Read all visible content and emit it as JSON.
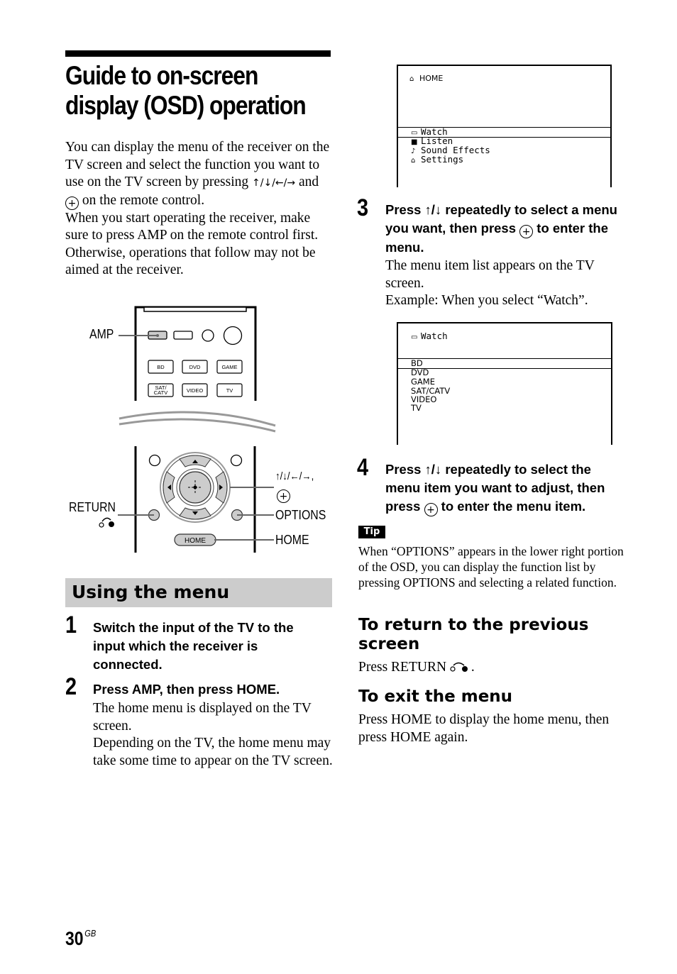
{
  "page": {
    "title_line1": "Guide to on-screen",
    "title_line2": "display (OSD) operation",
    "page_number": "30",
    "page_suffix": "GB"
  },
  "intro": {
    "line1_pre": "You can display the menu of the receiver on the TV screen and select the function you want to use on the TV screen by pressing ",
    "arrows": "↑/↓/←/→",
    "and": " and ",
    "enter_symbol": "+",
    "line1_post": " on the remote control.",
    "para2": "When you start operating the receiver, make sure to press AMP on the remote control first. Otherwise, operations that follow may not be aimed at the receiver."
  },
  "remote": {
    "callouts": {
      "amp": "AMP",
      "return": "RETURN",
      "arrows": "↑/↓/←/→,",
      "options": "OPTIONS",
      "home": "HOME"
    },
    "input_buttons": [
      "BD",
      "DVD",
      "GAME",
      "SAT/\nCATV",
      "VIDEO",
      "TV"
    ],
    "input_buttons_line1": [
      "BD",
      "DVD",
      "GAME",
      "SAT/",
      "VIDEO",
      "TV"
    ],
    "sat_line2": "CATV",
    "home_button": "HOME"
  },
  "section": {
    "title": "Using the menu"
  },
  "steps": [
    {
      "number": "1",
      "heading": "Switch the input of the TV to the input which the receiver is connected."
    },
    {
      "number": "2",
      "heading": "Press AMP, then press HOME.",
      "body1": "The home menu is displayed on the TV screen.",
      "body2": "Depending on the TV, the home menu may take some time to appear on the TV screen."
    },
    {
      "number": "3",
      "heading_pre": "Press ↑/↓ repeatedly to select a menu you want, then press ",
      "heading_post": " to enter the menu.",
      "body1": "The menu item list appears on the TV screen.",
      "body2": "Example: When you select “Watch”."
    },
    {
      "number": "4",
      "heading_pre": "Press ↑/↓ repeatedly to select the menu item you want to adjust, then press ",
      "heading_post": " to enter the menu item."
    }
  ],
  "osd_home": {
    "title": "HOME",
    "title_icon": "home-icon",
    "items": [
      {
        "label": "Watch",
        "icon": "▭",
        "icon_name": "tv-icon",
        "selected": true
      },
      {
        "label": "Listen",
        "icon": "■",
        "icon_name": "speaker-icon",
        "selected": false
      },
      {
        "label": "Sound Effects",
        "icon": "♪",
        "icon_name": "music-note-icon",
        "selected": false
      },
      {
        "label": "Settings",
        "icon": "⌂",
        "icon_name": "toolbox-icon",
        "selected": false
      }
    ]
  },
  "osd_watch": {
    "title": "Watch",
    "title_icon": "tv-icon",
    "items": [
      {
        "label": "BD",
        "selected": true
      },
      {
        "label": "DVD",
        "selected": false
      },
      {
        "label": "GAME",
        "selected": false
      },
      {
        "label": "SAT/CATV",
        "selected": false
      },
      {
        "label": "VIDEO",
        "selected": false
      },
      {
        "label": "TV",
        "selected": false
      }
    ]
  },
  "tip": {
    "badge": "Tip",
    "text": "When “OPTIONS” appears in the lower right portion of the OSD, you can display the function list by pressing OPTIONS and selecting a related function."
  },
  "return_section": {
    "heading": "To return to the previous screen",
    "body": "Press RETURN",
    "body_end": "."
  },
  "exit_section": {
    "heading": "To exit the menu",
    "body": "Press HOME to display the home menu, then press HOME again."
  }
}
